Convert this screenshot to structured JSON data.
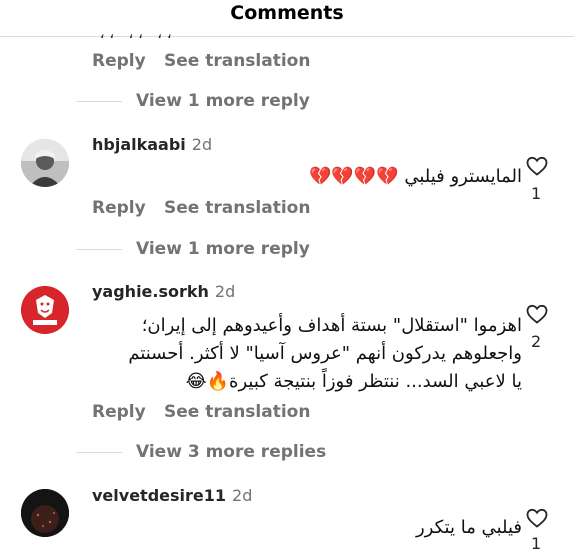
{
  "header": {
    "title": "Comments"
  },
  "top_comment": {
    "reply": "Reply",
    "translate": "See translation",
    "view_more": "View 1 more reply"
  },
  "comments": [
    {
      "username": "hbjalkaabi",
      "time": "2d",
      "text_lines": [
        "المايسترو فيلبي 💔💔💔💔"
      ],
      "likes": "1",
      "reply": "Reply",
      "translate": "See translation",
      "view_more": "View 1 more reply"
    },
    {
      "username": "yaghie.sorkh",
      "time": "2d",
      "text_lines": [
        "اهزموا \"استقلال\" بستة أهداف وأعيدوهم إلى إيران؛",
        "واجعلوهم يدركون أنهم \"عروس آسيا\" لا أكثر. أحسنتم",
        "يا لاعبي السد... ننتظر فوزاً بنتيجة كبيرة🔥😂"
      ],
      "likes": "2",
      "reply": "Reply",
      "translate": "See translation",
      "view_more": "View 3 more replies",
      "avatar_label": "YAGHIE.SORKH"
    },
    {
      "username": "velvetdesire11",
      "time": "2d",
      "text_lines": [
        "فيلبي ما يتكرر"
      ],
      "likes": "1"
    }
  ],
  "icons": {
    "like": "heart-outline-icon"
  },
  "colors": {
    "secondary_text": "#737373",
    "divider": "#dbdbdb",
    "avatar_red": "#d8242b"
  }
}
